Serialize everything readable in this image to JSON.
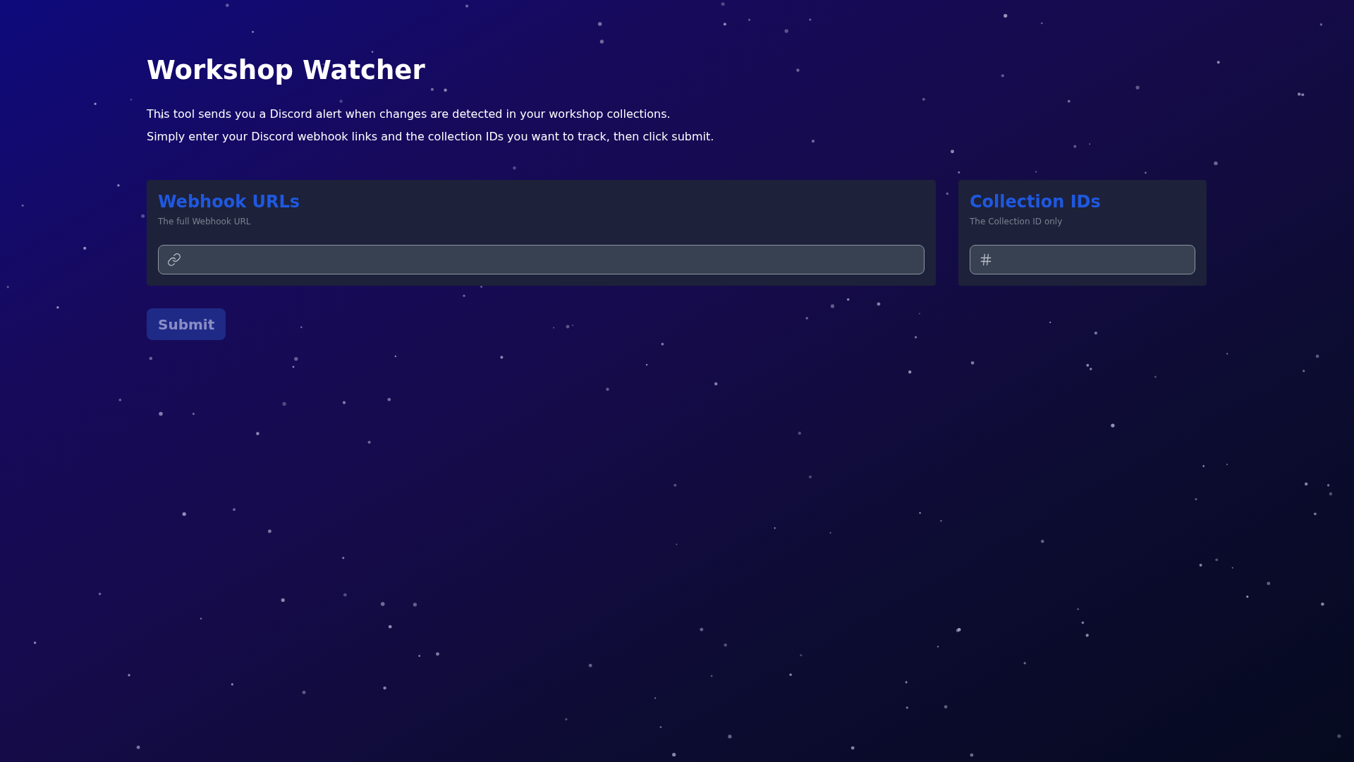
{
  "page": {
    "title": "Workshop Watcher",
    "description": [
      "This tool sends you a Discord alert when changes are detected in your workshop collections.",
      "Simply enter your Discord webhook links and the collection IDs you want to track, then click submit."
    ]
  },
  "sections": [
    {
      "title": "Webhook URLs",
      "subtitle": "The full Webhook URL",
      "input": {
        "kind": "url"
      }
    },
    {
      "title": "Collection IDs",
      "subtitle": "The Collection ID only",
      "input": {
        "kind": "id"
      }
    }
  ],
  "submit": {
    "label": "Submit",
    "disabled": true
  }
}
